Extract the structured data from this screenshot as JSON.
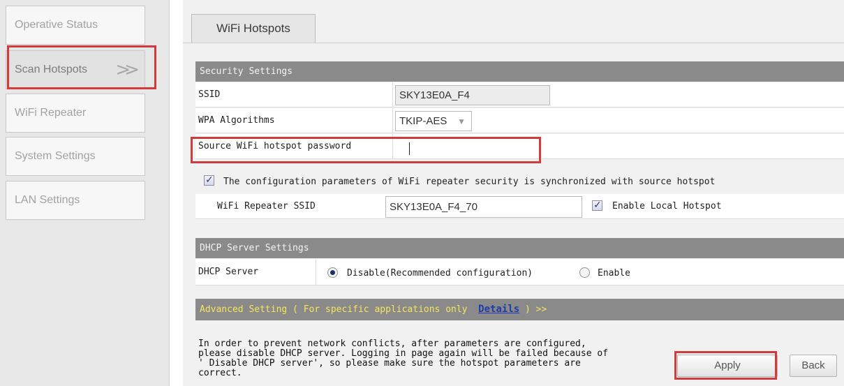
{
  "sidebar": {
    "items": [
      {
        "label": "Operative Status"
      },
      {
        "label": "Scan Hotspots",
        "arrow": ">>"
      },
      {
        "label": "WiFi Repeater"
      },
      {
        "label": "System Settings"
      },
      {
        "label": "LAN Settings"
      }
    ]
  },
  "page": {
    "tab_label": "WiFi Hotspots"
  },
  "security": {
    "section_title": "Security Settings",
    "ssid_label": "SSID",
    "ssid_value": "SKY13E0A_F4",
    "wpa_label": "WPA Algorithms",
    "wpa_value": "TKIP-AES",
    "password_label": "Source WiFi hotspot password",
    "password_value": "",
    "sync_label": "The configuration parameters of WiFi repeater security is synchronized with source hotspot",
    "sync_checked": true,
    "repeater_ssid_label": "WiFi Repeater SSID",
    "repeater_ssid_value": "SKY13E0A_F4_70",
    "enable_local_label": "Enable Local Hotspot",
    "enable_local_checked": true
  },
  "dhcp": {
    "section_title": "DHCP Server Settings",
    "label": "DHCP Server",
    "option_disable": "Disable(Recommended configuration)",
    "option_enable": "Enable",
    "selected": "disable"
  },
  "advanced": {
    "text_before": "Advanced Setting ( For specific applications only  ",
    "details_link": "Details",
    "text_after": " ) >>"
  },
  "note": {
    "text": "In order to prevent network conflicts, after parameters are configured,\nplease disable DHCP server. Logging in page again will be failed because of\n' Disable DHCP server', so please make sure the hotspot parameters are\ncorrect."
  },
  "buttons": {
    "apply": "Apply",
    "back": "Back"
  },
  "colors": {
    "highlight": "#d23b3b",
    "section_bar": "#8a8a8a",
    "advanced_text": "#f7e55b",
    "link": "#1f3ca8"
  }
}
